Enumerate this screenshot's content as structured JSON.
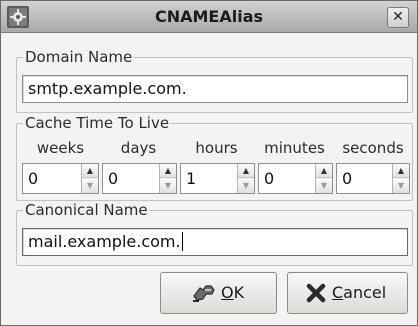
{
  "window": {
    "title": "CNAMEAlias",
    "close_glyph": "✕",
    "app_icon": "gear-icon"
  },
  "domain_group": {
    "legend": "Domain Name",
    "value": "smtp.example.com."
  },
  "cache_group": {
    "legend": "Cache Time To Live",
    "units": [
      {
        "label": "weeks",
        "value": "0"
      },
      {
        "label": "days",
        "value": "0"
      },
      {
        "label": "hours",
        "value": "1"
      },
      {
        "label": "minutes",
        "value": "0"
      },
      {
        "label": "seconds",
        "value": "0"
      }
    ],
    "arrow_up": "▲",
    "arrow_down": "▼"
  },
  "canonical_group": {
    "legend": "Canonical Name",
    "value": "mail.example.com."
  },
  "buttons": {
    "ok": {
      "mnemonic": "O",
      "rest": "K",
      "icon": "ok-hand-icon"
    },
    "cancel": {
      "mnemonic": "C",
      "rest": "ancel",
      "icon": "cancel-x-icon"
    }
  },
  "colors": {
    "window_bg": "#f4f3f1",
    "titlebar": "#a9a9a9",
    "cancel_icon": "#2b2b2b"
  }
}
